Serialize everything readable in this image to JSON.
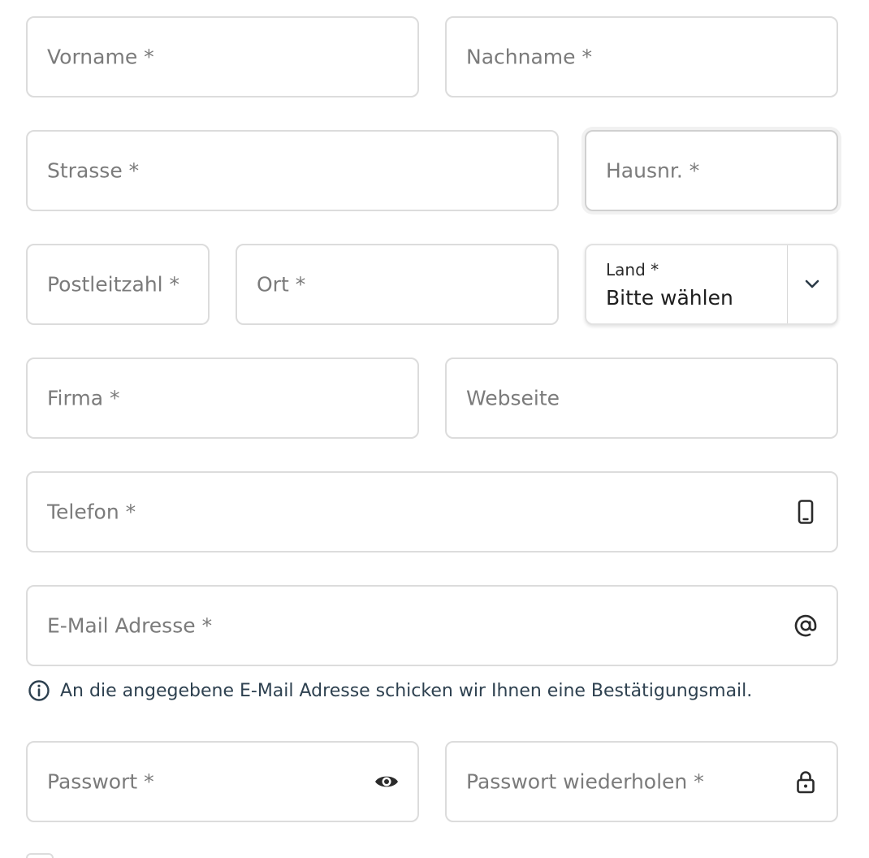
{
  "form": {
    "first_name": {
      "placeholder": "Vorname *"
    },
    "last_name": {
      "placeholder": "Nachname *"
    },
    "street": {
      "placeholder": "Strasse *"
    },
    "house_number": {
      "placeholder": "Hausnr. *"
    },
    "postal_code": {
      "placeholder": "Postleitzahl *"
    },
    "city": {
      "placeholder": "Ort *"
    },
    "country": {
      "label": "Land *",
      "value": "Bitte wählen",
      "icon": "chevron-down-icon"
    },
    "company": {
      "placeholder": "Firma *"
    },
    "website": {
      "placeholder": "Webseite"
    },
    "phone": {
      "placeholder": "Telefon *",
      "icon": "smartphone-icon"
    },
    "email": {
      "placeholder": "E-Mail Adresse *",
      "icon": "at-sign-icon"
    },
    "email_hint": {
      "text": "An die angegebene E-Mail Adresse schicken wir Ihnen eine Bestätigungsmail.",
      "icon": "info-icon"
    },
    "password": {
      "placeholder": "Passwort *",
      "icon": "eye-icon"
    },
    "password_repeat": {
      "placeholder": "Passwort wiederholen *",
      "icon": "lock-icon"
    }
  },
  "colors": {
    "border": "#dcdcdc",
    "placeholder": "#7b7b7b",
    "hint_text": "#2e4150"
  }
}
